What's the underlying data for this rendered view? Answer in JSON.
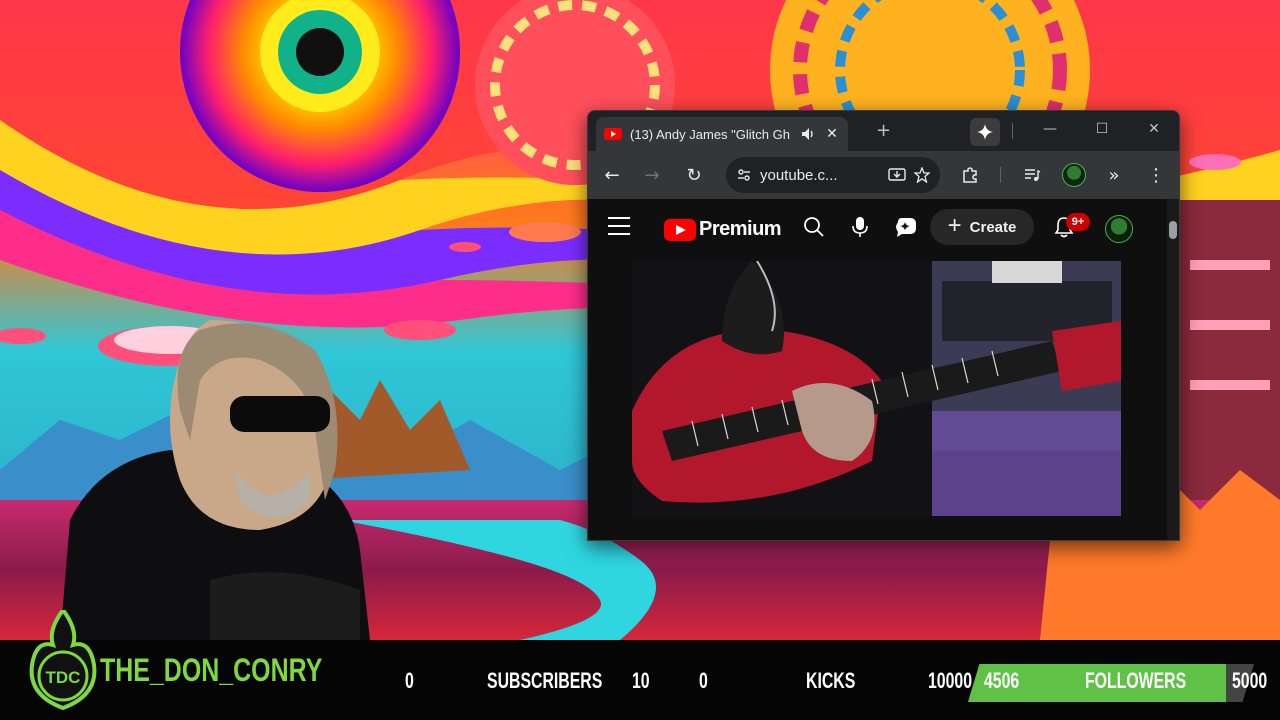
{
  "browser": {
    "tab_title": "(13) Andy James \"Glitch Gh",
    "tab_close": "✕",
    "new_tab": "+",
    "url": "youtube.c...",
    "window_controls": {
      "minimize": "—",
      "maximize": "☐",
      "close": "✕"
    }
  },
  "youtube": {
    "logo_text": "Premium",
    "create_label": "Create",
    "create_plus": "+",
    "notification_count": "9+"
  },
  "overlay": {
    "channel_name": "THE_DON_CONRY",
    "logo_text": "TDC",
    "subscribers": {
      "current": "0",
      "label": "SUBSCRIBERS",
      "goal": "10"
    },
    "kicks": {
      "current": "0",
      "label": "KICKS",
      "goal": "10000"
    },
    "followers": {
      "current": "4506",
      "label": "FOLLOWERS",
      "goal": "5000",
      "progress": 0.9012
    },
    "colors": {
      "brand_green": "#7dd93f",
      "progress_green": "#5fc246"
    }
  }
}
